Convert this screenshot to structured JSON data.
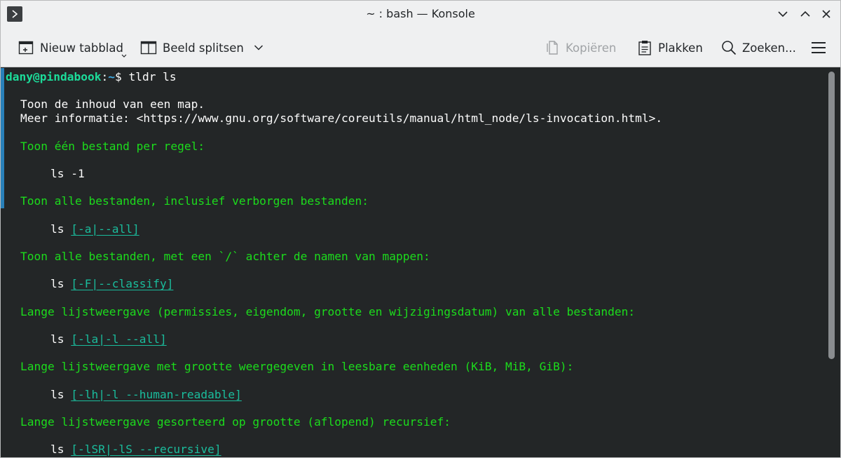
{
  "window": {
    "title": "~ : bash — Konsole"
  },
  "toolbar": {
    "new_tab": "Nieuw tabblad",
    "split_view": "Beeld splitsen",
    "copy": "Kopiëren",
    "paste": "Plakken",
    "find": "Zoeken..."
  },
  "terminal": {
    "prompt_user": "dany@pindabook",
    "prompt_sep": ":",
    "prompt_path": "~",
    "prompt_dollar": "$ ",
    "command": "tldr ls",
    "description": "Toon de inhoud van een map.",
    "more_info": "Meer informatie: <https://www.gnu.org/software/coreutils/manual/html_node/ls-invocation.html>.",
    "examples": [
      {
        "desc": "Toon één bestand per regel:",
        "cmd": "ls ",
        "args": "-1",
        "underline": false
      },
      {
        "desc": "Toon alle bestanden, inclusief verborgen bestanden:",
        "cmd": "ls ",
        "args": "[-a|--all]",
        "underline": true
      },
      {
        "desc": "Toon alle bestanden, met een `/` achter de namen van mappen:",
        "cmd": "ls ",
        "args": "[-F|--classify]",
        "underline": true
      },
      {
        "desc": "Lange lijstweergave (permissies, eigendom, grootte en wijzigingsdatum) van alle bestanden:",
        "cmd": "ls ",
        "args": "[-la|-l --all]",
        "underline": true
      },
      {
        "desc": "Lange lijstweergave met grootte weergegeven in leesbare eenheden (KiB, MiB, GiB):",
        "cmd": "ls ",
        "args": "[-lh|-l --human-readable]",
        "underline": true
      },
      {
        "desc": "Lange lijstweergave gesorteerd op grootte (aflopend) recursief:",
        "cmd": "ls ",
        "args": "[-lSR|-lS --recursive]",
        "underline": true
      }
    ]
  },
  "colors": {
    "prompt_user": "#1cdc9a",
    "prompt_path": "#3daee9",
    "description_green": "#1cdc1c",
    "option_teal": "#1abc9c",
    "terminal_bg": "#232627"
  }
}
